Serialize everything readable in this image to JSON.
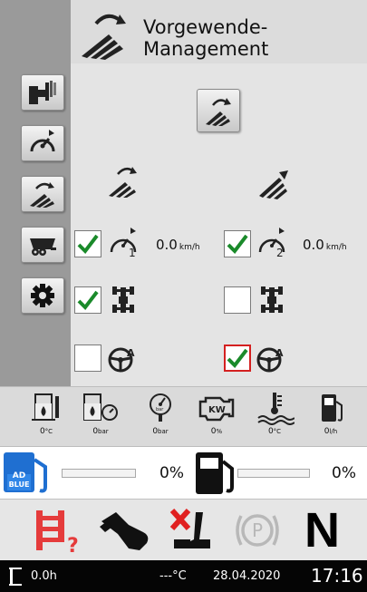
{
  "header": {
    "title_line1": "Vorgewende-",
    "title_line2": "Management",
    "icon": "headland-management-icon"
  },
  "sidebar": {
    "items": [
      {
        "icon": "implement-hitch-icon"
      },
      {
        "icon": "speedometer-icon"
      },
      {
        "icon": "headland-turn-icon"
      },
      {
        "icon": "trailer-truck-icon"
      },
      {
        "icon": "settings-gear-icon"
      }
    ]
  },
  "main": {
    "vm_button_icon": "headland-start-icon",
    "left_column_icon": "headland-turn-in-icon",
    "right_column_icon": "headland-turn-out-icon",
    "speed_left": {
      "value": "0.0",
      "unit": "km/h",
      "checked": true,
      "icon": "speedometer-1-icon"
    },
    "speed_right": {
      "value": "0.0",
      "unit": "km/h",
      "checked": true,
      "icon": "speedometer-2-icon"
    },
    "diff_lock_left": {
      "checked": true,
      "icon": "differential-lock-icon"
    },
    "diff_lock_right": {
      "checked": false,
      "icon": "differential-lock-icon"
    },
    "steering_left": {
      "checked": false,
      "icon": "auto-steering-icon"
    },
    "steering_right": {
      "checked": true,
      "alert": true,
      "icon": "auto-steering-icon"
    }
  },
  "gauges": [
    {
      "icon": "hydraulic-oil-temp-icon",
      "value": "0",
      "unit": "°C"
    },
    {
      "icon": "oil-pressure-icon",
      "value": "0",
      "unit": "bar"
    },
    {
      "icon": "air-pressure-gauge-icon",
      "value": "0",
      "unit": "bar"
    },
    {
      "icon": "engine-load-icon",
      "value": "0",
      "unit": "%"
    },
    {
      "icon": "coolant-temp-icon",
      "value": "0",
      "unit": "°C"
    },
    {
      "icon": "fuel-consumption-icon",
      "value": "0",
      "unit": "l/h"
    }
  ],
  "fuel": {
    "adblue_label": "AD BLUE",
    "adblue_percent": "0%",
    "adblue_level": 0,
    "diesel_percent": "0%",
    "diesel_level": 0
  },
  "status": {
    "icons": [
      "hitch-unknown-icon",
      "operator-hand-icon",
      "seat-absent-icon",
      "parking-brake-icon"
    ],
    "gear": "N"
  },
  "bottombar": {
    "hours": "0.0h",
    "temperature": "---°C",
    "date": "28.04.2020",
    "time": "17:16"
  },
  "colors": {
    "check_green": "#1a8a2a",
    "alert_red": "#d42020",
    "fuel_blue": "#3c8ad8",
    "status_red": "#e53b3b"
  }
}
